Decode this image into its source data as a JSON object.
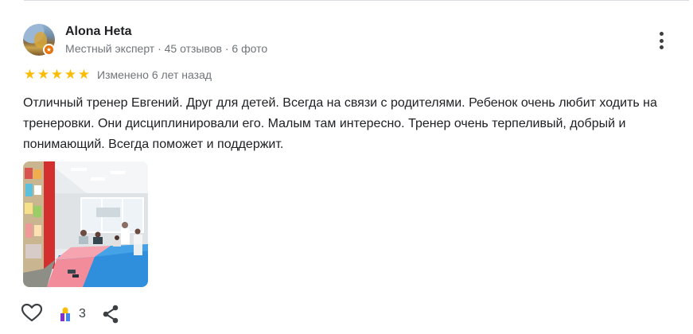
{
  "review": {
    "author": {
      "name": "Alona Heta",
      "meta": "Местный эксперт · 45 отзывов · 6 фото",
      "avatar_icon": "profile-photo",
      "badge_icon": "local-guide-star-icon",
      "badge_color": "#e8710a"
    },
    "rating": 5,
    "rating_max": 5,
    "edited": "Изменено 6 лет назад",
    "text": "Отличный тренер Евгений. Друг для детей. Всегда на связи с родителями. Ребенок очень любит ходить на тренеровки. Они дисциплинировали его. Малым там интересно. Тренер очень терпеливый, добрый и понимающий. Всегда поможет и поддержит.",
    "photo_icon": "gym-photo-thumbnail",
    "actions": {
      "like_icon": "heart-outline-icon",
      "award_icon": "award-icon",
      "award_count": "3",
      "share_icon": "share-icon",
      "more_icon": "more-vertical-icon"
    }
  },
  "colors": {
    "star": "#fbbc04",
    "text": "#202124",
    "secondary_text": "#70757a",
    "divider": "#dadce0"
  }
}
